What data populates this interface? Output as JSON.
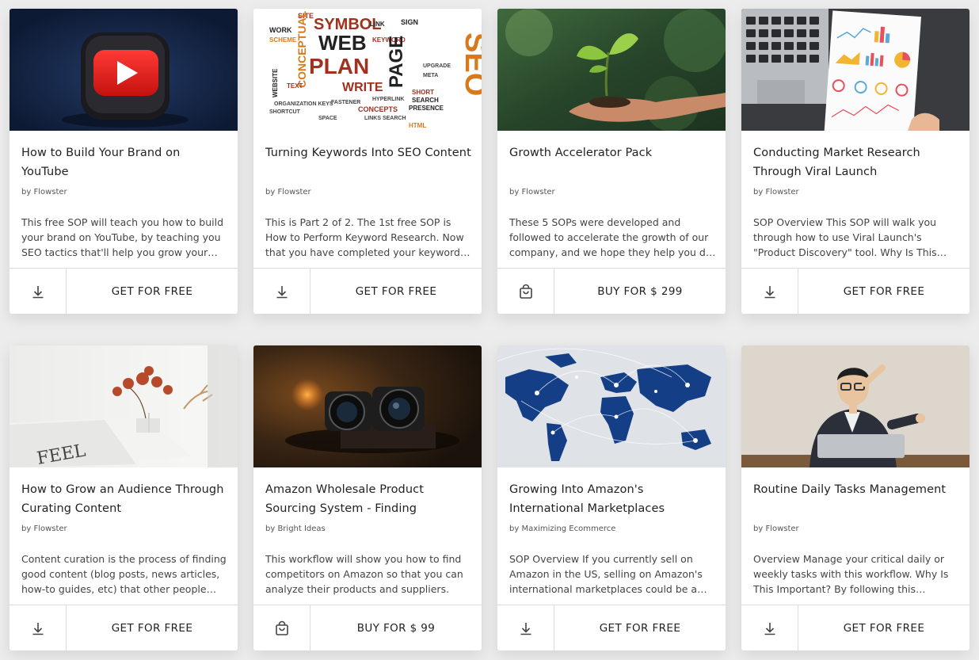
{
  "cards": [
    {
      "title": "How to Build Your Brand on YouTube",
      "author": "by Flowster",
      "description": "This free SOP will teach you how to build your brand on YouTube, by teaching you SEO tactics that'll help you grow your channel.",
      "action_label": "GET FOR FREE",
      "icon": "download-icon",
      "image": "youtube-logo-image"
    },
    {
      "title": "Turning Keywords Into SEO Content",
      "author": "by Flowster",
      "description": "This is Part 2 of 2. The 1st free SOP is How to Perform Keyword Research. Now that you have completed your keyword research you can start writing.",
      "action_label": "GET FOR FREE",
      "icon": "download-icon",
      "image": "seo-word-cloud-image",
      "word_cloud": [
        "SITE",
        "WORK",
        "SYMBOL",
        "LINK",
        "SIGN",
        "SCHEME",
        "WEB",
        "KEYWORD",
        "CONCEPTUAL",
        "SEO",
        "PLAN",
        "PAGE",
        "WEBSITE",
        "SEARCH",
        "TEXT",
        "WRITE",
        "SHORT",
        "PRESENCE",
        "CONCEPTS",
        "HTML"
      ]
    },
    {
      "title": "Growth Accelerator Pack",
      "author": "by Flowster",
      "description": "These 5 SOPs were developed and followed to accelerate the growth of our company, and we hope they help you do the same.",
      "action_label": "BUY FOR $ 299",
      "icon": "shopping-bag-icon",
      "image": "plant-seedling-image"
    },
    {
      "title": "Conducting Market Research Through Viral Launch",
      "author": "by Flowster",
      "description": "SOP Overview This SOP will walk you through how to use Viral Launch's \"Product Discovery\" tool. Why Is This Important?",
      "action_label": "GET FOR FREE",
      "icon": "download-icon",
      "image": "analytics-report-image"
    },
    {
      "title": "How to Grow an Audience Through Curating Content",
      "author": "by Flowster",
      "description": "Content curation is the process of finding good content (blog posts, news articles, how-to guides, etc) that other people have created.",
      "action_label": "GET FOR FREE",
      "icon": "download-icon",
      "image": "magazine-flowers-image"
    },
    {
      "title": "Amazon Wholesale Product Sourcing System - Finding Competitors",
      "author": "by Bright Ideas",
      "description": "This workflow will show you how to find competitors on Amazon so that you can analyze their products and suppliers.",
      "action_label": "BUY FOR $ 99",
      "icon": "shopping-bag-icon",
      "image": "binoculars-image"
    },
    {
      "title": "Growing Into Amazon's International Marketplaces",
      "author": "by Maximizing Ecommerce",
      "description": "SOP Overview If you currently sell on Amazon in the US, selling on Amazon's international marketplaces could be a great opportunity.",
      "action_label": "GET FOR FREE",
      "icon": "download-icon",
      "image": "world-map-image"
    },
    {
      "title": "Routine Daily Tasks Management",
      "author": "by Flowster",
      "description": "Overview Manage your critical daily or weekly tasks with this workflow. Why Is This Important? By following this workflow you stay on track.",
      "action_label": "GET FOR FREE",
      "icon": "download-icon",
      "image": "businessman-laptop-image"
    }
  ]
}
